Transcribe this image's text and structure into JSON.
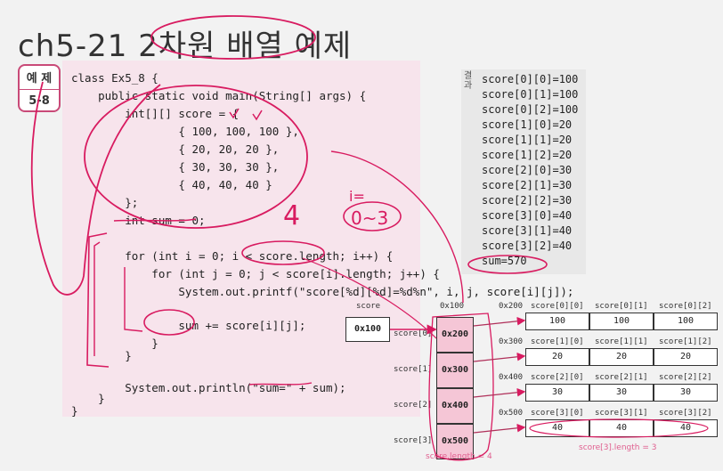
{
  "title": "ch5-21 2차원 배열 예제",
  "badge": {
    "top": "예 제",
    "bottom": "5-8"
  },
  "code": [
    "class Ex5_8 {",
    "    public static void main(String[] args) {",
    "        int[][] score = {",
    "                { 100, 100, 100 },",
    "                { 20, 20, 20 },",
    "                { 30, 30, 30 },",
    "                { 40, 40, 40 }",
    "        };",
    "        int sum = 0;",
    "",
    "        for (int i = 0; i < score.length; i++) {",
    "            for (int j = 0; j < score[i].length; j++) {",
    "                System.out.printf(\"score[%d][%d]=%d%n\", i, j, score[i][j]);",
    "",
    "                sum += score[i][j];",
    "            }",
    "        }",
    "",
    "        System.out.println(\"sum=\" + sum);",
    "    }",
    "}"
  ],
  "result": {
    "tag": "결과",
    "lines": [
      "score[0][0]=100",
      "score[0][1]=100",
      "score[0][2]=100",
      "score[1][0]=20",
      "score[1][1]=20",
      "score[1][2]=20",
      "score[2][0]=30",
      "score[2][1]=30",
      "score[2][2]=30",
      "score[3][0]=40",
      "score[3][1]=40",
      "score[3][2]=40",
      "sum=570"
    ]
  },
  "annotations": {
    "i_range_top": "i=",
    "i_range": "0~3",
    "four": "4"
  },
  "diagram": {
    "score_label": "score",
    "score_value": "0x100",
    "outer_addr": "0x100",
    "outer_rows": [
      {
        "label": "score[0]",
        "value": "0x200"
      },
      {
        "label": "score[1]",
        "value": "0x300"
      },
      {
        "label": "score[2]",
        "value": "0x400"
      },
      {
        "label": "score[3]",
        "value": "0x500"
      }
    ],
    "inner_rows": [
      {
        "addr": "0x200",
        "headers": [
          "score[0][0]",
          "score[0][1]",
          "score[0][2]"
        ],
        "values": [
          "100",
          "100",
          "100"
        ]
      },
      {
        "addr": "0x300",
        "headers": [
          "score[1][0]",
          "score[1][1]",
          "score[1][2]"
        ],
        "values": [
          "20",
          "20",
          "20"
        ]
      },
      {
        "addr": "0x400",
        "headers": [
          "score[2][0]",
          "score[2][1]",
          "score[2][2]"
        ],
        "values": [
          "30",
          "30",
          "30"
        ]
      },
      {
        "addr": "0x500",
        "headers": [
          "score[3][0]",
          "score[3][1]",
          "score[3][2]"
        ],
        "values": [
          "40",
          "40",
          "40"
        ]
      }
    ],
    "outer_length": "score.length = 4",
    "inner_length": "score[3].length = 3"
  },
  "colors": {
    "accent": "#c94a78",
    "ink": "#d81b60",
    "panel": "#f7e4ec",
    "result_bg": "#e8e8e8"
  }
}
